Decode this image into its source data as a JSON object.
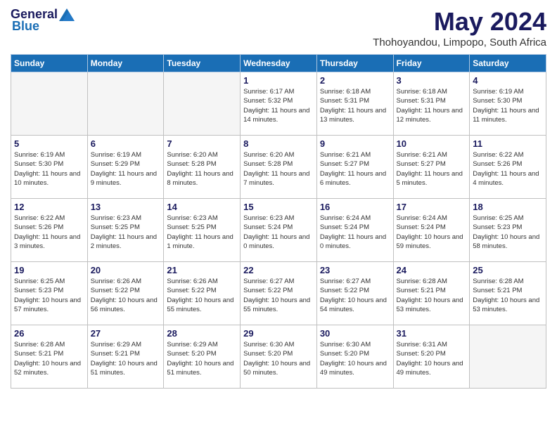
{
  "header": {
    "logo": {
      "general": "General",
      "blue": "Blue"
    },
    "title": "May 2024",
    "location": "Thohoyandou, Limpopo, South Africa"
  },
  "weekdays": [
    "Sunday",
    "Monday",
    "Tuesday",
    "Wednesday",
    "Thursday",
    "Friday",
    "Saturday"
  ],
  "weeks": [
    [
      {
        "day": "",
        "empty": true
      },
      {
        "day": "",
        "empty": true
      },
      {
        "day": "",
        "empty": true
      },
      {
        "day": "1",
        "info": "Sunrise: 6:17 AM\nSunset: 5:32 PM\nDaylight: 11 hours and 14 minutes."
      },
      {
        "day": "2",
        "info": "Sunrise: 6:18 AM\nSunset: 5:31 PM\nDaylight: 11 hours and 13 minutes."
      },
      {
        "day": "3",
        "info": "Sunrise: 6:18 AM\nSunset: 5:31 PM\nDaylight: 11 hours and 12 minutes."
      },
      {
        "day": "4",
        "info": "Sunrise: 6:19 AM\nSunset: 5:30 PM\nDaylight: 11 hours and 11 minutes."
      }
    ],
    [
      {
        "day": "5",
        "info": "Sunrise: 6:19 AM\nSunset: 5:30 PM\nDaylight: 11 hours and 10 minutes."
      },
      {
        "day": "6",
        "info": "Sunrise: 6:19 AM\nSunset: 5:29 PM\nDaylight: 11 hours and 9 minutes."
      },
      {
        "day": "7",
        "info": "Sunrise: 6:20 AM\nSunset: 5:28 PM\nDaylight: 11 hours and 8 minutes."
      },
      {
        "day": "8",
        "info": "Sunrise: 6:20 AM\nSunset: 5:28 PM\nDaylight: 11 hours and 7 minutes."
      },
      {
        "day": "9",
        "info": "Sunrise: 6:21 AM\nSunset: 5:27 PM\nDaylight: 11 hours and 6 minutes."
      },
      {
        "day": "10",
        "info": "Sunrise: 6:21 AM\nSunset: 5:27 PM\nDaylight: 11 hours and 5 minutes."
      },
      {
        "day": "11",
        "info": "Sunrise: 6:22 AM\nSunset: 5:26 PM\nDaylight: 11 hours and 4 minutes."
      }
    ],
    [
      {
        "day": "12",
        "info": "Sunrise: 6:22 AM\nSunset: 5:26 PM\nDaylight: 11 hours and 3 minutes."
      },
      {
        "day": "13",
        "info": "Sunrise: 6:23 AM\nSunset: 5:25 PM\nDaylight: 11 hours and 2 minutes."
      },
      {
        "day": "14",
        "info": "Sunrise: 6:23 AM\nSunset: 5:25 PM\nDaylight: 11 hours and 1 minute."
      },
      {
        "day": "15",
        "info": "Sunrise: 6:23 AM\nSunset: 5:24 PM\nDaylight: 11 hours and 0 minutes."
      },
      {
        "day": "16",
        "info": "Sunrise: 6:24 AM\nSunset: 5:24 PM\nDaylight: 11 hours and 0 minutes."
      },
      {
        "day": "17",
        "info": "Sunrise: 6:24 AM\nSunset: 5:24 PM\nDaylight: 10 hours and 59 minutes."
      },
      {
        "day": "18",
        "info": "Sunrise: 6:25 AM\nSunset: 5:23 PM\nDaylight: 10 hours and 58 minutes."
      }
    ],
    [
      {
        "day": "19",
        "info": "Sunrise: 6:25 AM\nSunset: 5:23 PM\nDaylight: 10 hours and 57 minutes."
      },
      {
        "day": "20",
        "info": "Sunrise: 6:26 AM\nSunset: 5:22 PM\nDaylight: 10 hours and 56 minutes."
      },
      {
        "day": "21",
        "info": "Sunrise: 6:26 AM\nSunset: 5:22 PM\nDaylight: 10 hours and 55 minutes."
      },
      {
        "day": "22",
        "info": "Sunrise: 6:27 AM\nSunset: 5:22 PM\nDaylight: 10 hours and 55 minutes."
      },
      {
        "day": "23",
        "info": "Sunrise: 6:27 AM\nSunset: 5:22 PM\nDaylight: 10 hours and 54 minutes."
      },
      {
        "day": "24",
        "info": "Sunrise: 6:28 AM\nSunset: 5:21 PM\nDaylight: 10 hours and 53 minutes."
      },
      {
        "day": "25",
        "info": "Sunrise: 6:28 AM\nSunset: 5:21 PM\nDaylight: 10 hours and 53 minutes."
      }
    ],
    [
      {
        "day": "26",
        "info": "Sunrise: 6:28 AM\nSunset: 5:21 PM\nDaylight: 10 hours and 52 minutes."
      },
      {
        "day": "27",
        "info": "Sunrise: 6:29 AM\nSunset: 5:21 PM\nDaylight: 10 hours and 51 minutes."
      },
      {
        "day": "28",
        "info": "Sunrise: 6:29 AM\nSunset: 5:20 PM\nDaylight: 10 hours and 51 minutes."
      },
      {
        "day": "29",
        "info": "Sunrise: 6:30 AM\nSunset: 5:20 PM\nDaylight: 10 hours and 50 minutes."
      },
      {
        "day": "30",
        "info": "Sunrise: 6:30 AM\nSunset: 5:20 PM\nDaylight: 10 hours and 49 minutes."
      },
      {
        "day": "31",
        "info": "Sunrise: 6:31 AM\nSunset: 5:20 PM\nDaylight: 10 hours and 49 minutes."
      },
      {
        "day": "",
        "empty": true
      }
    ]
  ]
}
